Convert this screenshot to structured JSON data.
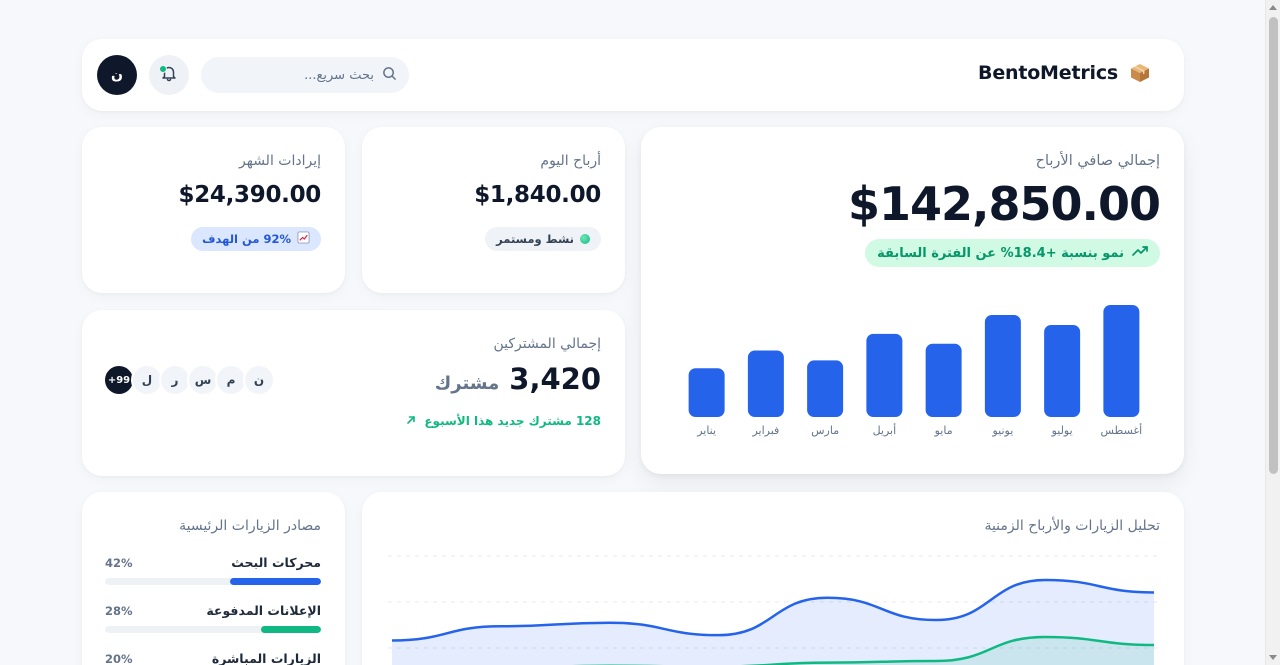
{
  "header": {
    "brand_name": "BentoMetrics",
    "brand_icon": "package-icon",
    "search_placeholder": "بحث سريع...",
    "avatar_letter": "ن",
    "notification_dot_color": "#10b981"
  },
  "month_revenue": {
    "title": "إيرادات الشهر",
    "value": "$24,390.00",
    "badge": "92% من الهدف"
  },
  "today_profit": {
    "title": "أرباح اليوم",
    "value": "$1,840.00",
    "badge": "نشط ومستمر"
  },
  "net_profit": {
    "title": "إجمالي صافي الأرباح",
    "value": "$142,850.00",
    "growth": "نمو بنسبة +18.4% عن الفترة السابقة"
  },
  "chart_data": {
    "type": "bar",
    "categories": [
      "يناير",
      "فبراير",
      "مارس",
      "أبريل",
      "مايو",
      "يونيو",
      "يوليو",
      "أغسطس"
    ],
    "values": [
      44,
      60,
      51,
      75,
      66,
      92,
      83,
      101
    ],
    "ylim": [
      0,
      110
    ],
    "bar_color": "#2563eb"
  },
  "subscribers": {
    "title": "إجمالي المشتركين",
    "value": "3,420",
    "unit": "مشترك",
    "new_text": "128 مشترك جديد هذا الأسبوع",
    "avatars": [
      "ن",
      "م",
      "س",
      "ر",
      "ل"
    ],
    "more": "+99"
  },
  "sources": {
    "title": "مصادر الزيارات الرئيسية",
    "items": [
      {
        "label": "محركات البحث",
        "pct": "42%",
        "value": 42,
        "color": "#2563eb"
      },
      {
        "label": "الإعلانات المدفوعة",
        "pct": "28%",
        "value": 28,
        "color": "#10b981"
      },
      {
        "label": "الزيارات المباشرة",
        "pct": "20%",
        "value": 20,
        "color": "#f59e0b"
      }
    ]
  },
  "analysis": {
    "title": "تحليل الزيارات والأرباح الزمنية",
    "visits": [
      32,
      48,
      52,
      38,
      80,
      55,
      100,
      86
    ],
    "profits": [
      0,
      2,
      4,
      3,
      8,
      10,
      40,
      30
    ],
    "visits_color": "#2563eb",
    "profits_color": "#10b981"
  }
}
